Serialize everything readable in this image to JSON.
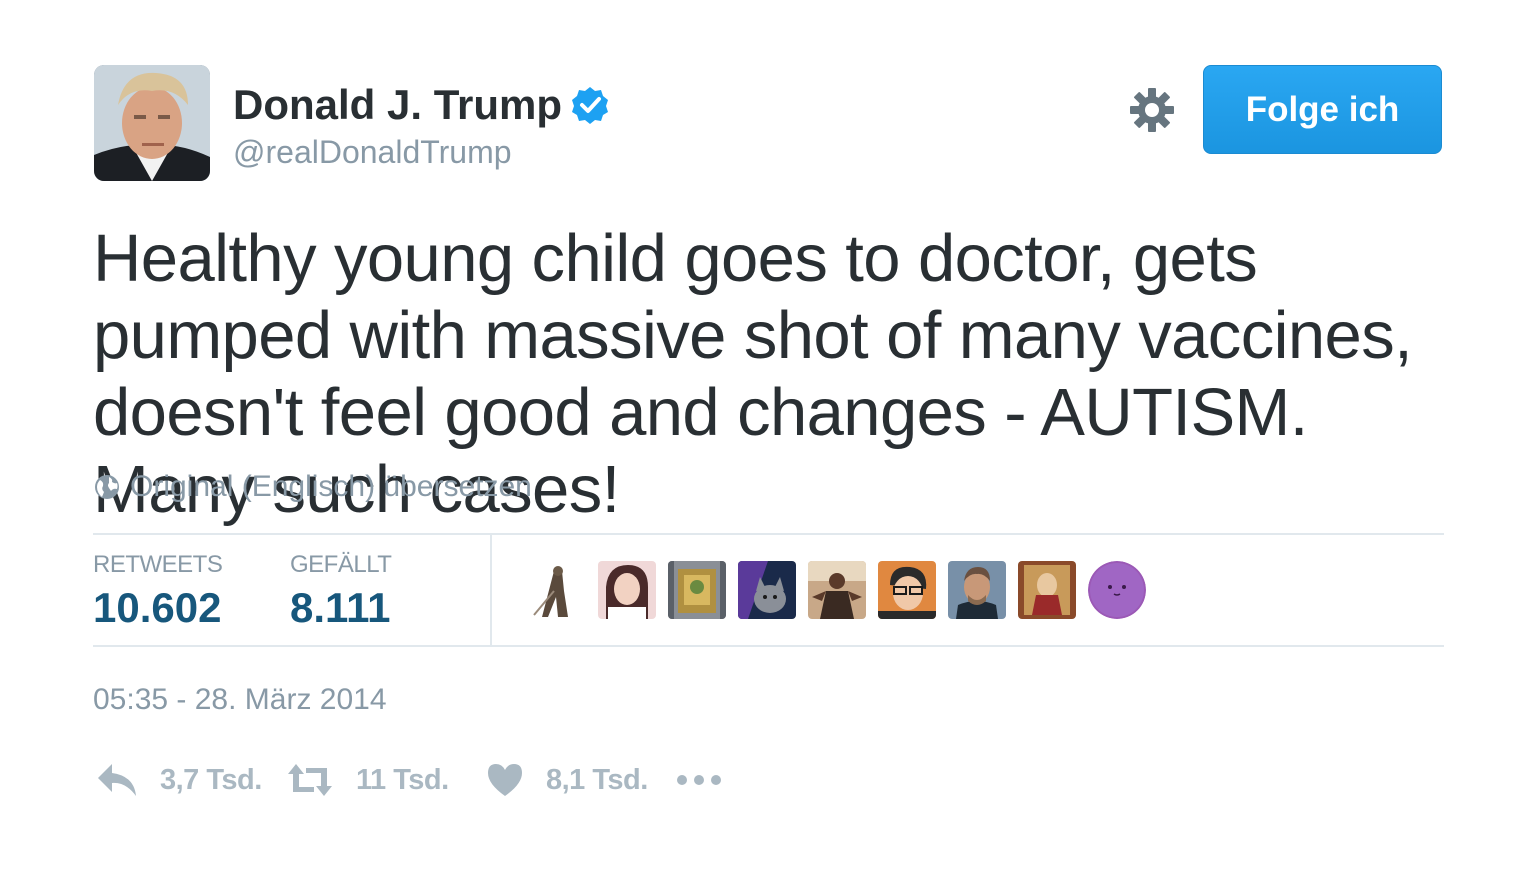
{
  "author": {
    "name": "Donald J. Trump",
    "handle": "@realDonaldTrump",
    "verified": true
  },
  "follow_button": {
    "label": "Folge ich"
  },
  "tweet": {
    "text": "Healthy young child goes to doctor, gets pumped with massive shot of many vaccines, doesn't feel good and changes - AUTISM. Many such cases!",
    "translate_label": "Original (Englisch) übersetzen",
    "timestamp": "05:35 - 28. März 2014"
  },
  "stats": {
    "retweets_label": "RETWEETS",
    "retweets_value": "10.602",
    "likes_label": "GEFÄLLT",
    "likes_value": "8.111"
  },
  "actions": {
    "reply_count": "3,7 Tsd.",
    "retweet_count": "11 Tsd.",
    "like_count": "8,1 Tsd."
  },
  "colors": {
    "accent": "#1da1f2",
    "text": "#292f33",
    "muted": "#8899a6",
    "stat_value": "#17577c",
    "action_icon": "#aab8c2",
    "divider": "#e1e8ed"
  },
  "icons": [
    "verified-badge-icon",
    "gear-icon",
    "globe-icon",
    "reply-icon",
    "retweet-icon",
    "heart-icon",
    "more-icon"
  ]
}
